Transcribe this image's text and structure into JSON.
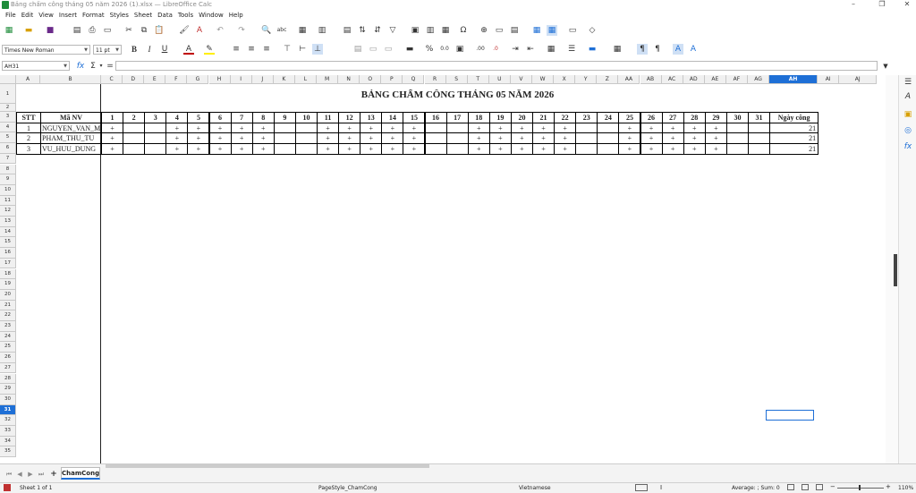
{
  "window": {
    "title": "Bảng chấm công tháng 05 năm 2026 (1).xlsx — LibreOffice Calc"
  },
  "menu": [
    "File",
    "Edit",
    "View",
    "Insert",
    "Format",
    "Styles",
    "Sheet",
    "Data",
    "Tools",
    "Window",
    "Help"
  ],
  "format_toolbar": {
    "font_name": "Times New Roman",
    "font_size": "11 pt"
  },
  "formula_bar": {
    "name_box": "AH31",
    "content": ""
  },
  "sheet": {
    "title": "BẢNG CHẤM CÔNG THÁNG 05 NĂM 2026",
    "header": {
      "stt": "STT",
      "ma_nv": "Mã NV",
      "total": "Ngày công"
    },
    "days": [
      "1",
      "2",
      "3",
      "4",
      "5",
      "6",
      "7",
      "8",
      "9",
      "10",
      "11",
      "12",
      "13",
      "14",
      "15",
      "16",
      "17",
      "18",
      "19",
      "20",
      "21",
      "22",
      "23",
      "24",
      "25",
      "26",
      "27",
      "28",
      "29",
      "30",
      "31"
    ],
    "mark": "+",
    "rows": [
      {
        "stt": "1",
        "ma_nv": "NGUYEN_VAN_M",
        "total": "21",
        "marks": [
          1,
          0,
          0,
          1,
          1,
          1,
          1,
          1,
          0,
          0,
          1,
          1,
          1,
          1,
          1,
          0,
          0,
          1,
          1,
          1,
          1,
          1,
          0,
          0,
          1,
          1,
          1,
          1,
          1,
          0,
          0
        ]
      },
      {
        "stt": "2",
        "ma_nv": "PHAM_THU_TU",
        "total": "21",
        "marks": [
          1,
          0,
          0,
          1,
          1,
          1,
          1,
          1,
          0,
          0,
          1,
          1,
          1,
          1,
          1,
          0,
          0,
          1,
          1,
          1,
          1,
          1,
          0,
          0,
          1,
          1,
          1,
          1,
          1,
          0,
          0
        ]
      },
      {
        "stt": "3",
        "ma_nv": "VU_HUU_DUNG",
        "total": "21",
        "marks": [
          1,
          0,
          0,
          1,
          1,
          1,
          1,
          1,
          0,
          0,
          1,
          1,
          1,
          1,
          1,
          0,
          0,
          1,
          1,
          1,
          1,
          1,
          0,
          0,
          1,
          1,
          1,
          1,
          1,
          0,
          0
        ]
      }
    ]
  },
  "columns": [
    "A",
    "B",
    "C",
    "D",
    "E",
    "F",
    "G",
    "H",
    "I",
    "J",
    "K",
    "L",
    "M",
    "N",
    "O",
    "P",
    "Q",
    "R",
    "S",
    "T",
    "U",
    "V",
    "W",
    "X",
    "Y",
    "Z",
    "AA",
    "AB",
    "AC",
    "AD",
    "AE",
    "AF",
    "AG",
    "AH",
    "AI",
    "AJ"
  ],
  "row_numbers": [
    "1",
    "2",
    "3",
    "4",
    "5",
    "6",
    "7",
    "8",
    "9",
    "10",
    "11",
    "12",
    "13",
    "14",
    "15",
    "16",
    "17",
    "18",
    "19",
    "20",
    "21",
    "22",
    "23",
    "24",
    "25",
    "26",
    "27",
    "28",
    "29",
    "30",
    "31",
    "32",
    "33",
    "34",
    "35"
  ],
  "selected": {
    "column": "AH",
    "row": "31"
  },
  "tabs": {
    "active": "ChamCong"
  },
  "status": {
    "sheet": "Sheet 1 of 1",
    "page_style": "PageStyle_ChamCong",
    "language": "Vietnamese",
    "summary": "Average: ; Sum: 0",
    "zoom": "110%"
  }
}
